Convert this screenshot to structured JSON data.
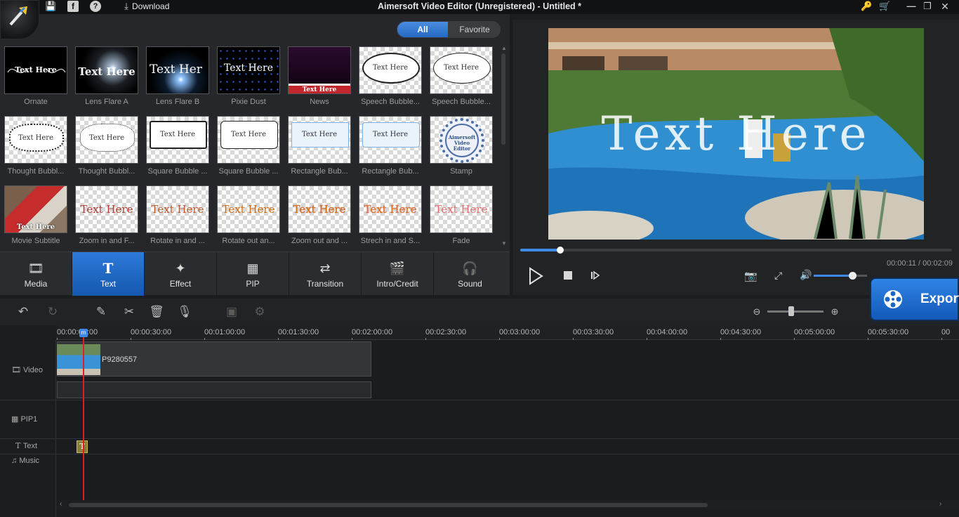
{
  "window": {
    "title": "Aimersoft Video Editor (Unregistered) - Untitled *",
    "download_label": "Download"
  },
  "library": {
    "filter": {
      "all": "All",
      "favorite": "Favorite"
    },
    "items": [
      {
        "label": "Ornate",
        "thumb_text": "Text Here"
      },
      {
        "label": "Lens Flare A",
        "thumb_text": "Text Here"
      },
      {
        "label": "Lens Flare B",
        "thumb_text": "Text Her"
      },
      {
        "label": "Pixie Dust",
        "thumb_text": "Text Here"
      },
      {
        "label": "News",
        "thumb_text": "Text Here"
      },
      {
        "label": "Speech Bubble...",
        "thumb_text": "Text Here"
      },
      {
        "label": "Speech Bubble...",
        "thumb_text": "Text Here"
      },
      {
        "label": "Thought Bubbl...",
        "thumb_text": "Text Here"
      },
      {
        "label": "Thought Bubbl...",
        "thumb_text": "Text Here"
      },
      {
        "label": "Square Bubble ...",
        "thumb_text": "Text Here"
      },
      {
        "label": "Square Bubble ...",
        "thumb_text": "Text Here"
      },
      {
        "label": "Rectangle Bub...",
        "thumb_text": "Text Here"
      },
      {
        "label": "Rectangle Bub...",
        "thumb_text": "Text Here"
      },
      {
        "label": "Stamp",
        "thumb_text": "Aimersoft Video Editor"
      },
      {
        "label": "Movie Subtitle",
        "thumb_text": "Text Here"
      },
      {
        "label": "Zoom in and F...",
        "thumb_text": "Text Here"
      },
      {
        "label": "Rotate in and ...",
        "thumb_text": "Text Here"
      },
      {
        "label": "Rotate out an...",
        "thumb_text": "Text Here"
      },
      {
        "label": "Zoom out and ...",
        "thumb_text": "Text Here"
      },
      {
        "label": "Strech in and S...",
        "thumb_text": "Text Here"
      },
      {
        "label": "Fade",
        "thumb_text": "Text Here"
      }
    ]
  },
  "categories": {
    "media": "Media",
    "text": "Text",
    "effect": "Effect",
    "pip": "PIP",
    "transition": "Transition",
    "intro_credit": "Intro/Credit",
    "sound": "Sound"
  },
  "preview": {
    "overlay_text": "Text Here",
    "time_display": "00:00:11 / 00:02:09",
    "progress_fraction": 0.092,
    "volume_fraction": 0.72
  },
  "export_label": "Export",
  "timeline": {
    "ruler_ticks": [
      "00:00:00:00",
      "00:00:30:00",
      "00:01:00:00",
      "00:01:30:00",
      "00:02:00:00",
      "00:02:30:00",
      "00:03:00:00",
      "00:03:30:00",
      "00:04:00:00",
      "00:04:30:00",
      "00:05:00:00",
      "00:05:30:00",
      "00"
    ],
    "tracks": {
      "video": "Video",
      "pip1": "PIP1",
      "text": "Text",
      "music": "Music"
    },
    "clip_name": "P9280557",
    "text_clip_glyph": "T",
    "playhead_glyph": "m"
  },
  "colors": {
    "accent": "#2d7ad8",
    "playhead": "#e02020",
    "background": "#1c1d1f"
  }
}
